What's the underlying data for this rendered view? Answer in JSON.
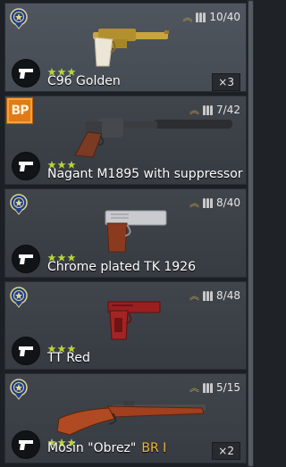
{
  "colors": {
    "card_bg": "#3a3f46",
    "stars": "#b8d23a",
    "rank": "#f0b63a",
    "bp_badge": "#e07b16"
  },
  "items": [
    {
      "name": "C96 Golden",
      "rank": "",
      "ammo": "10/40",
      "count": "×3",
      "badge": "medal",
      "stars": 3
    },
    {
      "name": "Nagant M1895 with suppressor",
      "rank": "",
      "ammo": "7/42",
      "count": "",
      "badge": "BP",
      "stars": 3
    },
    {
      "name": "Chrome plated TK 1926",
      "rank": "",
      "ammo": "8/40",
      "count": "",
      "badge": "medal",
      "stars": 3
    },
    {
      "name": "TT Red",
      "rank": "",
      "ammo": "8/48",
      "count": "",
      "badge": "medal",
      "stars": 3
    },
    {
      "name": "Mosin \"Obrez\"",
      "rank": "BR I",
      "ammo": "5/15",
      "count": "×2",
      "badge": "medal",
      "stars": 3
    }
  ]
}
